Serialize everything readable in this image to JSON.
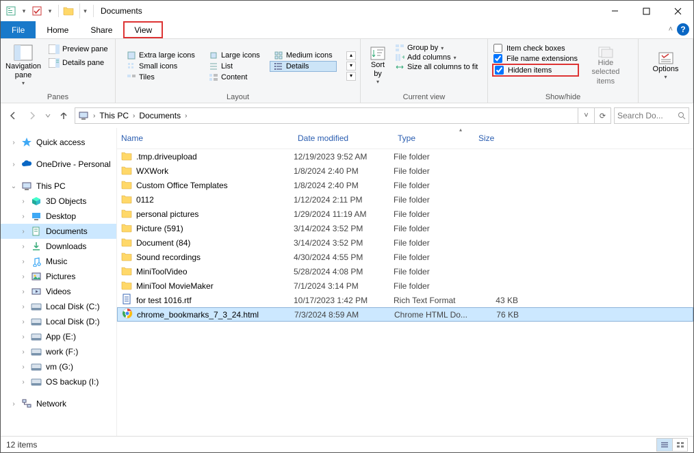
{
  "title": "Documents",
  "menu": {
    "file": "File",
    "home": "Home",
    "share": "Share",
    "view": "View"
  },
  "ribbon": {
    "panes": {
      "navigation": "Navigation\npane",
      "preview": "Preview pane",
      "details": "Details pane",
      "group": "Panes"
    },
    "layout": {
      "xl": "Extra large icons",
      "l": "Large icons",
      "m": "Medium icons",
      "s": "Small icons",
      "list": "List",
      "details": "Details",
      "tiles": "Tiles",
      "content": "Content",
      "group": "Layout"
    },
    "currentview": {
      "sortby": "Sort\nby",
      "groupby": "Group by",
      "addcols": "Add columns",
      "sizeall": "Size all columns to fit",
      "group": "Current view"
    },
    "showhide": {
      "itemcheck": "Item check boxes",
      "fnext": "File name extensions",
      "hidden": "Hidden items",
      "hidesel": "Hide selected\nitems",
      "group": "Show/hide"
    },
    "options": "Options"
  },
  "address": {
    "thispc": "This PC",
    "documents": "Documents"
  },
  "search_placeholder": "Search Do...",
  "tree": {
    "quick": "Quick access",
    "onedrive": "OneDrive - Personal",
    "thispc": "This PC",
    "objects3d": "3D Objects",
    "desktop": "Desktop",
    "documents": "Documents",
    "downloads": "Downloads",
    "music": "Music",
    "pictures": "Pictures",
    "videos": "Videos",
    "ldc": "Local Disk (C:)",
    "ldd": "Local Disk (D:)",
    "appe": "App (E:)",
    "workf": "work (F:)",
    "vmg": "vm (G:)",
    "osbak": "OS backup (I:)",
    "network": "Network"
  },
  "columns": {
    "name": "Name",
    "date": "Date modified",
    "type": "Type",
    "size": "Size"
  },
  "files": [
    {
      "icon": "folder",
      "name": ".tmp.driveupload",
      "date": "12/19/2023 9:52 AM",
      "type": "File folder",
      "size": ""
    },
    {
      "icon": "folder",
      "name": "WXWork",
      "date": "1/8/2024 2:40 PM",
      "type": "File folder",
      "size": ""
    },
    {
      "icon": "folder",
      "name": "Custom Office Templates",
      "date": "1/8/2024 2:40 PM",
      "type": "File folder",
      "size": ""
    },
    {
      "icon": "folder",
      "name": "0112",
      "date": "1/12/2024 2:11 PM",
      "type": "File folder",
      "size": ""
    },
    {
      "icon": "folder",
      "name": "personal pictures",
      "date": "1/29/2024 11:19 AM",
      "type": "File folder",
      "size": ""
    },
    {
      "icon": "folder",
      "name": "Picture (591)",
      "date": "3/14/2024 3:52 PM",
      "type": "File folder",
      "size": ""
    },
    {
      "icon": "folder",
      "name": "Document (84)",
      "date": "3/14/2024 3:52 PM",
      "type": "File folder",
      "size": ""
    },
    {
      "icon": "folder",
      "name": "Sound recordings",
      "date": "4/30/2024 4:55 PM",
      "type": "File folder",
      "size": ""
    },
    {
      "icon": "folder",
      "name": "MiniToolVideo",
      "date": "5/28/2024 4:08 PM",
      "type": "File folder",
      "size": ""
    },
    {
      "icon": "folder",
      "name": "MiniTool MovieMaker",
      "date": "7/1/2024 3:14 PM",
      "type": "File folder",
      "size": ""
    },
    {
      "icon": "rtf",
      "name": "for test 1016.rtf",
      "date": "10/17/2023 1:42 PM",
      "type": "Rich Text Format",
      "size": "43 KB"
    },
    {
      "icon": "chrome",
      "name": "chrome_bookmarks_7_3_24.html",
      "date": "7/3/2024 8:59 AM",
      "type": "Chrome HTML Do...",
      "size": "76 KB",
      "selected": true
    }
  ],
  "status": "12 items",
  "checks": {
    "itemcheck": false,
    "fnext": true,
    "hidden": true
  }
}
